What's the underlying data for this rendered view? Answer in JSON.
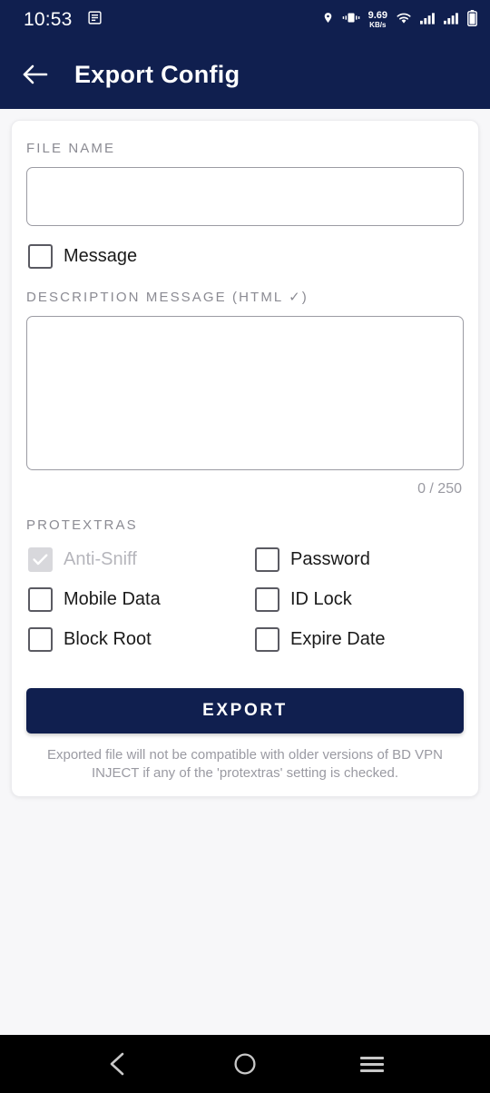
{
  "status_bar": {
    "time": "10:53",
    "notification_icon": "document-note-icon",
    "location_icon": "location-pin-icon",
    "vibrate_icon": "vibrate-icon",
    "net_speed_value": "9.69",
    "net_speed_unit": "KB/s",
    "wifi_icon": "wifi-icon",
    "signal_icon_1": "signal-bars-icon",
    "signal_icon_2": "signal-bars-icon",
    "battery_icon": "battery-icon",
    "background_color": "#101f4f"
  },
  "app_bar": {
    "back_icon": "back-arrow-icon",
    "title": "Export Config",
    "background_color": "#101f4f"
  },
  "form": {
    "file_name_label": "FILE NAME",
    "file_name_value": "",
    "file_name_placeholder": "",
    "message_checkbox": {
      "label": "Message",
      "checked": false
    },
    "description_label": "DESCRIPTION MESSAGE (HTML ✓)",
    "description_value": "",
    "description_placeholder": "",
    "counter": "0 / 250"
  },
  "protextras": {
    "section_label": "PROTEXTRAS",
    "items": [
      {
        "label": "Anti-Sniff",
        "checked": true,
        "disabled": true,
        "check_glyph": "✓"
      },
      {
        "label": "Password",
        "checked": false,
        "disabled": false,
        "check_glyph": ""
      },
      {
        "label": "Mobile Data",
        "checked": false,
        "disabled": false,
        "check_glyph": ""
      },
      {
        "label": "ID Lock",
        "checked": false,
        "disabled": false,
        "check_glyph": ""
      },
      {
        "label": "Block Root",
        "checked": false,
        "disabled": false,
        "check_glyph": ""
      },
      {
        "label": "Expire Date",
        "checked": false,
        "disabled": false,
        "check_glyph": ""
      }
    ]
  },
  "actions": {
    "export_label": "EXPORT",
    "export_color": "#101f4f"
  },
  "footer": {
    "note": "Exported file will not be compatible with older versions of BD VPN INJECT if any of the 'protextras' setting is checked."
  },
  "nav_bar": {
    "back_icon": "nav-back-icon",
    "home_icon": "nav-home-icon",
    "recents_icon": "nav-recents-icon",
    "background_color": "#000000"
  }
}
